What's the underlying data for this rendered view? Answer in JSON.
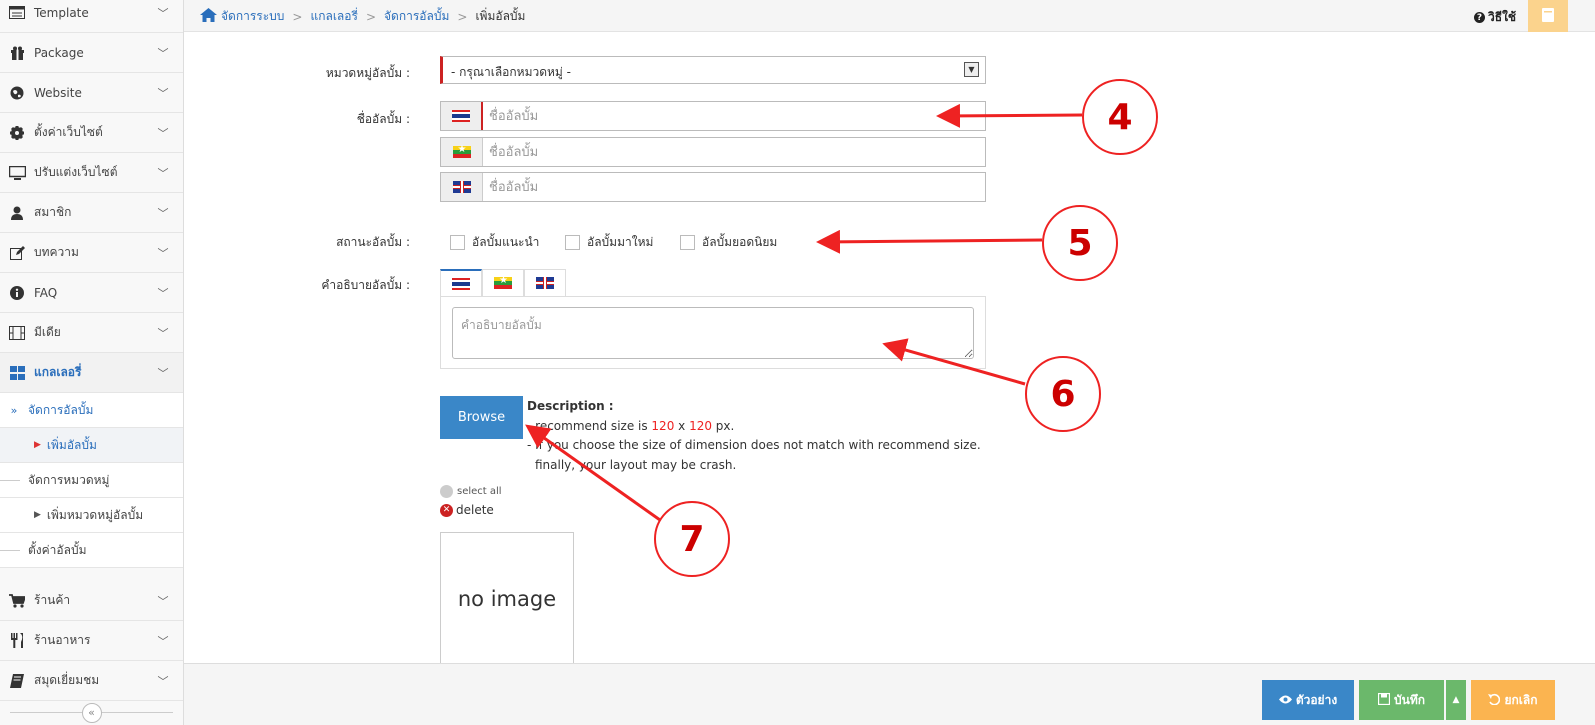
{
  "sidebar": {
    "items": [
      {
        "label": "Template",
        "icon": "template-icon"
      },
      {
        "label": "Package",
        "icon": "gift-icon"
      },
      {
        "label": "Website",
        "icon": "globe-icon"
      },
      {
        "label": "ตั้งค่าเว็บไซต์",
        "icon": "gear-icon"
      },
      {
        "label": "ปรับแต่งเว็บไซต์",
        "icon": "monitor-icon"
      },
      {
        "label": "สมาชิก",
        "icon": "user-icon"
      },
      {
        "label": "บทความ",
        "icon": "edit-icon"
      },
      {
        "label": "FAQ",
        "icon": "info-icon"
      },
      {
        "label": "มีเดีย",
        "icon": "film-icon"
      },
      {
        "label": "แกลเลอรี่",
        "icon": "grid-icon"
      },
      {
        "label": "ร้านค้า",
        "icon": "cart-icon"
      },
      {
        "label": "ร้านอาหาร",
        "icon": "utensils-icon"
      },
      {
        "label": "สมุดเยี่ยมชม",
        "icon": "book-icon"
      }
    ],
    "sub_items": [
      {
        "label": "จัดการอัลบั้ม"
      },
      {
        "label": "เพิ่มอัลบั้ม"
      },
      {
        "label": "จัดการหมวดหมู่"
      },
      {
        "label": "เพิ่มหมวดหมู่อัลบั้ม"
      },
      {
        "label": "ตั้งค่าอัลบั้ม"
      }
    ],
    "collapse_label": "«"
  },
  "breadcrumb": {
    "home": "จัดการระบบ",
    "gallery": "แกลเลอรี่",
    "manage": "จัดการอัลบั้ม",
    "current": "เพิ่มอัลบั้ม",
    "separator": ">"
  },
  "help_label": "วิธีใช้",
  "form": {
    "category_label": "หมวดหมู่อัลบั้ม :",
    "category_value": "- กรุณาเลือกหมวดหมู่ -",
    "name_label": "ชื่ออัลบั้ม :",
    "name_placeholder": "ชื่ออัลบั้ม",
    "status_label": "สถานะอัลบั้ม :",
    "status_options": [
      "อัลบั้มแนะนำ",
      "อัลบั้มมาใหม่",
      "อัลบั้มยอดนิยม"
    ],
    "desc_label": "คำอธิบายอัลบั้ม :",
    "desc_placeholder": "คำอธิบายอัลบั้ม"
  },
  "upload": {
    "browse_label": "Browse",
    "desc_title": "Description :",
    "line1_prefix": "- recommend size is ",
    "size_w": "120",
    "size_x": " x ",
    "size_h": "120",
    "line1_suffix": " px.",
    "line2": "- If you choose the size of dimension does not match with recommend size.",
    "line3": "finally, your layout may be crash.",
    "select_all": "select all",
    "delete": "delete",
    "no_image": "no image"
  },
  "buttons": {
    "preview": "ตัวอย่าง",
    "save": "บันทึก",
    "cancel": "ยกเลิก"
  },
  "callouts": [
    "4",
    "5",
    "6",
    "7"
  ],
  "colors": {
    "accent_blue": "#3a87c8",
    "save_green": "#6bb86b",
    "cancel_orange": "#fbb450",
    "annotation_red": "#e22222"
  }
}
